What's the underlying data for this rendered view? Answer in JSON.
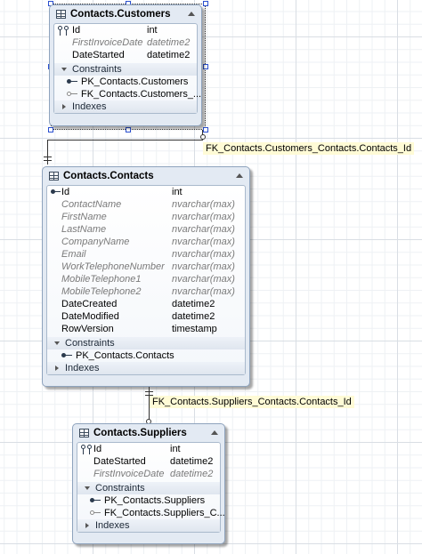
{
  "customers": {
    "title": "Contacts.Customers",
    "rows": [
      {
        "name": "Id",
        "type": "int"
      },
      {
        "name": "FirstInvoiceDate",
        "type": "datetime2"
      },
      {
        "name": "DateStarted",
        "type": "datetime2"
      }
    ],
    "constraints_label": "Constraints",
    "constraints": [
      "PK_Contacts.Customers",
      "FK_Contacts.Customers_..."
    ],
    "indexes_label": "Indexes"
  },
  "contacts": {
    "title": "Contacts.Contacts",
    "rows": [
      {
        "name": "Id",
        "type": "int"
      },
      {
        "name": "ContactName",
        "type": "nvarchar(max)"
      },
      {
        "name": "FirstName",
        "type": "nvarchar(max)"
      },
      {
        "name": "LastName",
        "type": "nvarchar(max)"
      },
      {
        "name": "CompanyName",
        "type": "nvarchar(max)"
      },
      {
        "name": "Email",
        "type": "nvarchar(max)"
      },
      {
        "name": "WorkTelephoneNumber",
        "type": "nvarchar(max)"
      },
      {
        "name": "MobileTelephone1",
        "type": "nvarchar(max)"
      },
      {
        "name": "MobileTelephone2",
        "type": "nvarchar(max)"
      },
      {
        "name": "DateCreated",
        "type": "datetime2"
      },
      {
        "name": "DateModified",
        "type": "datetime2"
      },
      {
        "name": "RowVersion",
        "type": "timestamp"
      }
    ],
    "constraints_label": "Constraints",
    "constraints": [
      "PK_Contacts.Contacts"
    ],
    "indexes_label": "Indexes"
  },
  "suppliers": {
    "title": "Contacts.Suppliers",
    "rows": [
      {
        "name": "Id",
        "type": "int"
      },
      {
        "name": "DateStarted",
        "type": "datetime2"
      },
      {
        "name": "FirstInvoiceDate",
        "type": "datetime2"
      }
    ],
    "constraints_label": "Constraints",
    "constraints": [
      "PK_Contacts.Suppliers",
      "FK_Contacts.Suppliers_C..."
    ],
    "indexes_label": "Indexes"
  },
  "relationships": {
    "customers_fk": "FK_Contacts.Customers_Contacts.Contacts_Id",
    "suppliers_fk": "FK_Contacts.Suppliers_Contacts.Contacts_Id"
  }
}
